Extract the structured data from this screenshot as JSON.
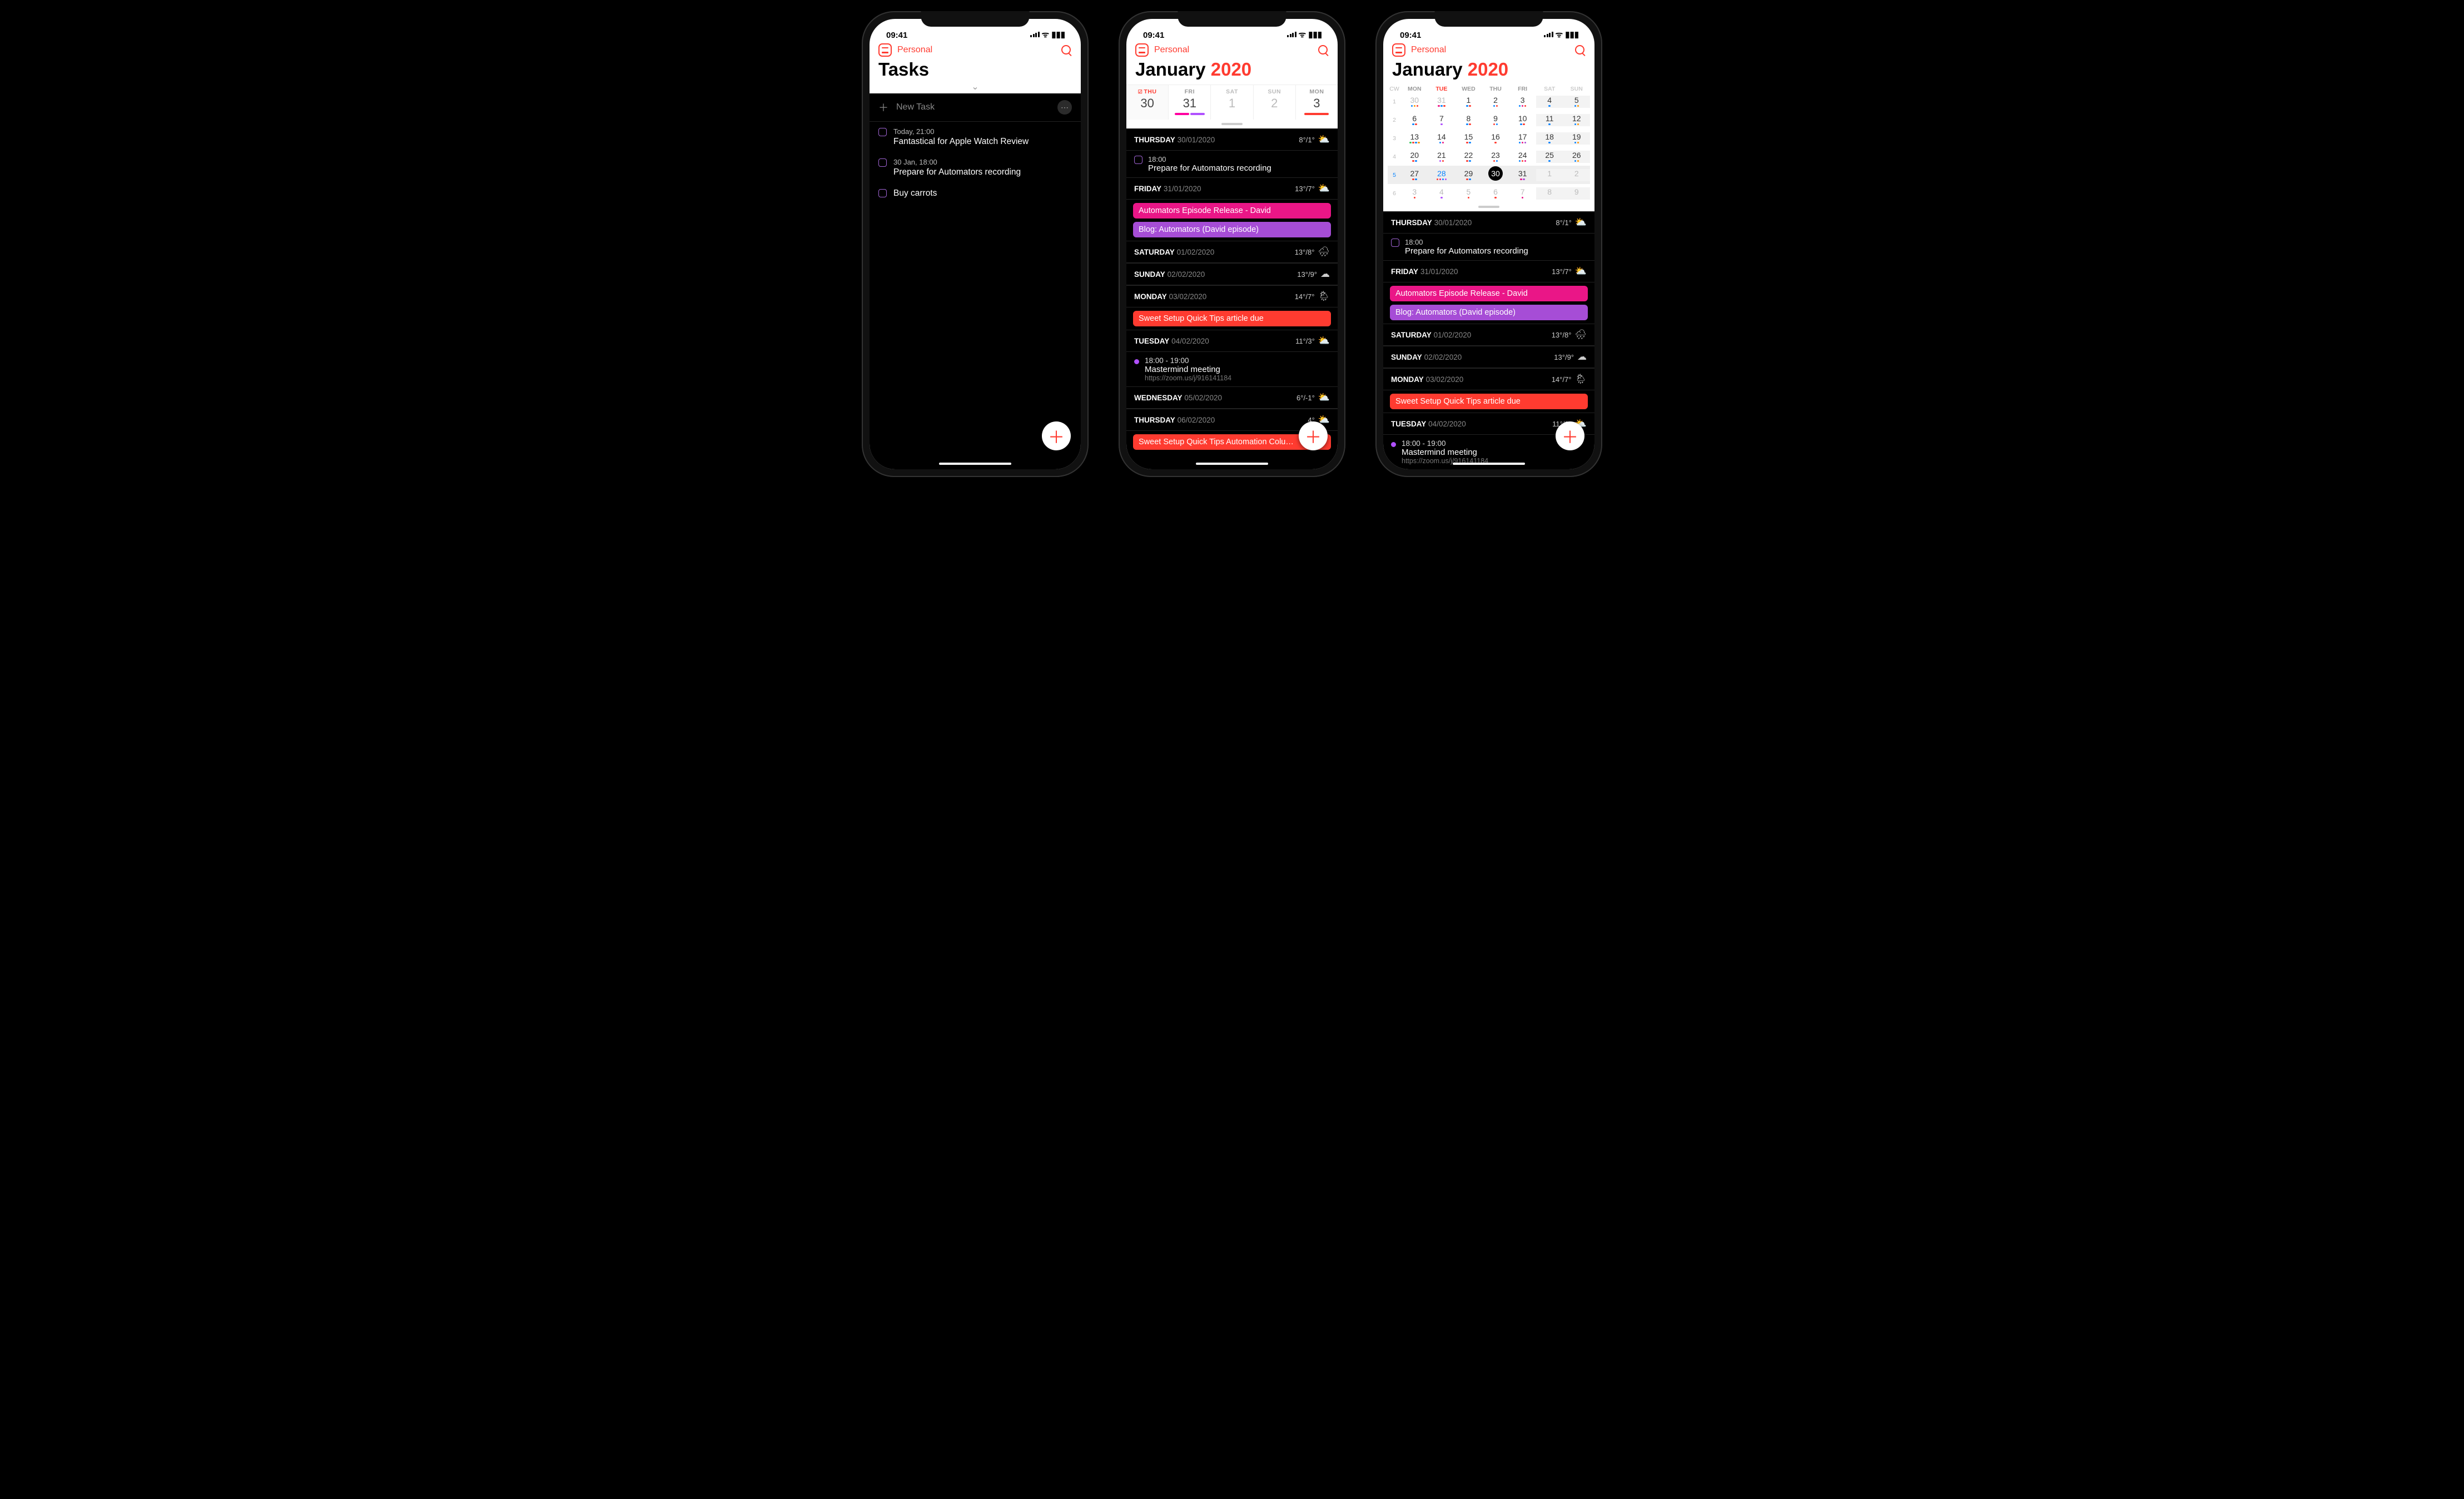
{
  "status_time": "09:41",
  "nav_label": "Personal",
  "colors": {
    "accent": "#ff3b30",
    "pink": "#ea1687",
    "purple": "#a64dd6",
    "red": "#ff3b30",
    "magenta": "#ff00a0",
    "violet": "#b050ff",
    "blue": "#0a84ff",
    "orange": "#ff9500",
    "green": "#34c759"
  },
  "phone1": {
    "title": "Tasks",
    "newtask_label": "New Task",
    "tasks": [
      {
        "meta": "Today, 21:00",
        "title": "Fantastical for Apple Watch Review"
      },
      {
        "meta": "30 Jan, 18:00",
        "title": "Prepare for Automators recording"
      },
      {
        "meta": "",
        "title": "Buy carrots"
      }
    ]
  },
  "phone2": {
    "title_month": "January",
    "title_year": "2020",
    "week": [
      {
        "dow": "THU",
        "num": "30",
        "sel": true,
        "check": true,
        "bars": []
      },
      {
        "dow": "FRI",
        "num": "31",
        "bars": [
          [
            "#ff00a0",
            26
          ],
          [
            "#b050ff",
            26
          ]
        ]
      },
      {
        "dow": "SAT",
        "num": "1",
        "gray": true,
        "bars": []
      },
      {
        "dow": "SUN",
        "num": "2",
        "gray": true,
        "bars": []
      },
      {
        "dow": "MON",
        "num": "3",
        "bars": [
          [
            "#ff3b30",
            44
          ]
        ]
      }
    ],
    "agenda": [
      {
        "type": "hdr",
        "name": "THURSDAY",
        "date": "30/01/2020",
        "temp": "8°/1°",
        "icon": "⛅"
      },
      {
        "type": "task",
        "meta": "18:00",
        "title": "Prepare for Automators recording"
      },
      {
        "type": "hdr",
        "name": "FRIDAY",
        "date": "31/01/2020",
        "temp": "13°/7°",
        "icon": "⛅"
      },
      {
        "type": "pill",
        "color": "#ea1687",
        "title": "Automators Episode Release - David"
      },
      {
        "type": "pill",
        "color": "#a64dd6",
        "title": "Blog: Automators (David episode)"
      },
      {
        "type": "hdr",
        "name": "SATURDAY",
        "date": "01/02/2020",
        "temp": "13°/8°",
        "icon": "🌧"
      },
      {
        "type": "hdr",
        "name": "SUNDAY",
        "date": "02/02/2020",
        "temp": "13°/9°",
        "icon": "☁"
      },
      {
        "type": "hdr",
        "name": "MONDAY",
        "date": "03/02/2020",
        "temp": "14°/7°",
        "icon": "🌦"
      },
      {
        "type": "pill",
        "color": "#ff3b30",
        "title": "Sweet Setup Quick Tips article due"
      },
      {
        "type": "hdr",
        "name": "TUESDAY",
        "date": "04/02/2020",
        "temp": "11°/3°",
        "icon": "⛅"
      },
      {
        "type": "ev",
        "dot": "#b050ff",
        "time": "18:00 - 19:00",
        "title": "Mastermind meeting",
        "link": "https://zoom.us/j/916141184"
      },
      {
        "type": "hdr",
        "name": "WEDNESDAY",
        "date": "05/02/2020",
        "temp": "6°/-1°",
        "icon": "⛅"
      },
      {
        "type": "hdr",
        "name": "THURSDAY",
        "date": "06/02/2020",
        "temp": "4°",
        "icon": "⛅"
      },
      {
        "type": "pill",
        "color": "#ff3b30",
        "title": "Sweet Setup Quick Tips Automation Colu…"
      }
    ]
  },
  "phone3": {
    "title_month": "January",
    "title_year": "2020",
    "month_hdr": [
      "CW",
      "MON",
      "TUE",
      "WED",
      "THU",
      "FRI",
      "SAT",
      "SUN"
    ],
    "month": [
      {
        "cw": "1",
        "cells": [
          {
            "n": "30",
            "out": true,
            "dots": [
              "#0a84ff",
              "#ff9500",
              "#ff3b30"
            ]
          },
          {
            "n": "31",
            "out": true,
            "dots": [
              "#ea1687",
              "#0a84ff",
              "#ff3b30"
            ]
          },
          {
            "n": "1",
            "dots": [
              "#0a84ff",
              "#ff3b30"
            ]
          },
          {
            "n": "2",
            "dots": [
              "#0a84ff",
              "#ff3b30"
            ]
          },
          {
            "n": "3",
            "dots": [
              "#0a84ff",
              "#ea1687",
              "#ff3b30"
            ]
          },
          {
            "n": "4",
            "wknd": true,
            "dots": [
              "#0a84ff"
            ]
          },
          {
            "n": "5",
            "wknd": true,
            "dots": [
              "#0a84ff",
              "#ff9500"
            ]
          }
        ]
      },
      {
        "cw": "2",
        "cells": [
          {
            "n": "6",
            "dots": [
              "#0a84ff",
              "#ff3b30"
            ]
          },
          {
            "n": "7",
            "dots": [
              "#b050ff"
            ]
          },
          {
            "n": "8",
            "dots": [
              "#0a84ff",
              "#ff3b30"
            ]
          },
          {
            "n": "9",
            "dots": [
              "#ff3b30",
              "#0a84ff"
            ]
          },
          {
            "n": "10",
            "dots": [
              "#0a84ff",
              "#ff3b30"
            ]
          },
          {
            "n": "11",
            "wknd": true,
            "dots": [
              "#0a84ff"
            ]
          },
          {
            "n": "12",
            "wknd": true,
            "dots": [
              "#0a84ff",
              "#ff9500"
            ]
          }
        ]
      },
      {
        "cw": "3",
        "cells": [
          {
            "n": "13",
            "dots": [
              "#34c759",
              "#ff3b30",
              "#0a84ff",
              "#ff9500"
            ]
          },
          {
            "n": "14",
            "dots": [
              "#0a84ff",
              "#ea1687"
            ]
          },
          {
            "n": "15",
            "dots": [
              "#ff3b30",
              "#0a84ff"
            ]
          },
          {
            "n": "16",
            "dots": [
              "#ff3b30"
            ]
          },
          {
            "n": "17",
            "dots": [
              "#0a84ff",
              "#ea1687",
              "#a64dd6"
            ]
          },
          {
            "n": "18",
            "wknd": true,
            "dots": [
              "#0a84ff"
            ]
          },
          {
            "n": "19",
            "wknd": true,
            "dots": [
              "#0a84ff",
              "#ff9500"
            ]
          }
        ]
      },
      {
        "cw": "4",
        "cells": [
          {
            "n": "20",
            "dots": [
              "#ff3b30",
              "#0a84ff"
            ]
          },
          {
            "n": "21",
            "dots": [
              "#b050ff",
              "#ff3b30"
            ]
          },
          {
            "n": "22",
            "dots": [
              "#ff3b30",
              "#0a84ff"
            ]
          },
          {
            "n": "23",
            "dots": [
              "#ff3b30",
              "#0a84ff"
            ]
          },
          {
            "n": "24",
            "dots": [
              "#0a84ff",
              "#ff3b30",
              "#ea1687"
            ]
          },
          {
            "n": "25",
            "wknd": true,
            "dots": [
              "#0a84ff"
            ]
          },
          {
            "n": "26",
            "wknd": true,
            "dots": [
              "#0a84ff",
              "#ff9500"
            ]
          }
        ]
      },
      {
        "cw": "5",
        "sel": true,
        "cells": [
          {
            "n": "27",
            "dots": [
              "#ff3b30",
              "#0a84ff"
            ]
          },
          {
            "n": "28",
            "tueblue": true,
            "dots": [
              "#ff3b30",
              "#ea1687",
              "#0a84ff",
              "#b050ff"
            ]
          },
          {
            "n": "29",
            "dots": [
              "#ff3b30",
              "#0a84ff"
            ]
          },
          {
            "n": "30",
            "today": true,
            "dots": []
          },
          {
            "n": "31",
            "dots": [
              "#ea1687",
              "#a64dd6"
            ]
          },
          {
            "n": "1",
            "wknd": true,
            "out": true,
            "dots": []
          },
          {
            "n": "2",
            "wknd": true,
            "out": true,
            "dots": []
          }
        ]
      },
      {
        "cw": "6",
        "cells": [
          {
            "n": "3",
            "out": true,
            "dots": [
              "#ff3b30"
            ]
          },
          {
            "n": "4",
            "out": true,
            "dots": [
              "#b050ff"
            ]
          },
          {
            "n": "5",
            "out": true,
            "dots": [
              "#ff3b30"
            ]
          },
          {
            "n": "6",
            "out": true,
            "dots": [
              "#ff3b30"
            ]
          },
          {
            "n": "7",
            "out": true,
            "dots": [
              "#ea1687"
            ]
          },
          {
            "n": "8",
            "wknd": true,
            "out": true,
            "dots": []
          },
          {
            "n": "9",
            "wknd": true,
            "out": true,
            "dots": []
          }
        ]
      }
    ],
    "agenda": [
      {
        "type": "hdr",
        "name": "THURSDAY",
        "date": "30/01/2020",
        "temp": "8°/1°",
        "icon": "⛅"
      },
      {
        "type": "task",
        "meta": "18:00",
        "title": "Prepare for Automators recording"
      },
      {
        "type": "hdr",
        "name": "FRIDAY",
        "date": "31/01/2020",
        "temp": "13°/7°",
        "icon": "⛅"
      },
      {
        "type": "pill",
        "color": "#ea1687",
        "title": "Automators Episode Release - David"
      },
      {
        "type": "pill",
        "color": "#a64dd6",
        "title": "Blog: Automators (David episode)"
      },
      {
        "type": "hdr",
        "name": "SATURDAY",
        "date": "01/02/2020",
        "temp": "13°/8°",
        "icon": "🌧"
      },
      {
        "type": "hdr",
        "name": "SUNDAY",
        "date": "02/02/2020",
        "temp": "13°/9°",
        "icon": "☁"
      },
      {
        "type": "hdr",
        "name": "MONDAY",
        "date": "03/02/2020",
        "temp": "14°/7°",
        "icon": "🌦"
      },
      {
        "type": "pill",
        "color": "#ff3b30",
        "title": "Sweet Setup Quick Tips article due"
      },
      {
        "type": "hdr",
        "name": "TUESDAY",
        "date": "04/02/2020",
        "temp": "11°/3°",
        "icon": "⛅"
      },
      {
        "type": "ev",
        "dot": "#b050ff",
        "time": "18:00 - 19:00",
        "title": "Mastermind meeting",
        "link": "https://zoom.us/j/916141184"
      }
    ]
  }
}
